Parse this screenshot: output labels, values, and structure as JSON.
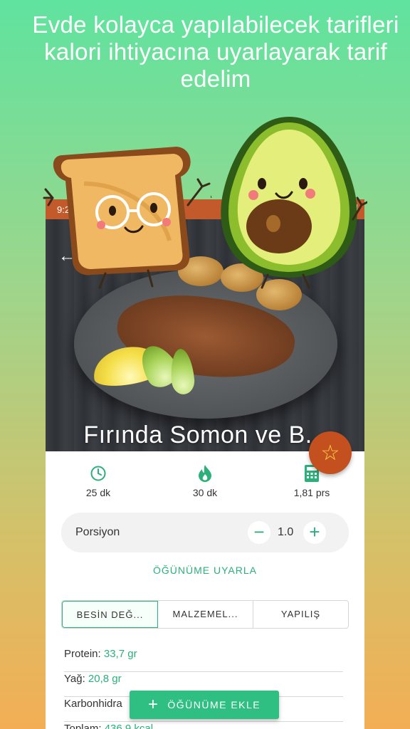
{
  "headline": "Evde kolayca yapılabilecek tarifleri kalori ihtiyacına uyarlayarak tarif edelim",
  "status_bar": {
    "time": "9:2"
  },
  "recipe": {
    "title": "Fırında Somon ve B..."
  },
  "stats": [
    {
      "icon": "clock-icon",
      "value": "25 dk"
    },
    {
      "icon": "flame-icon",
      "value": "30 dk"
    },
    {
      "icon": "calculator-icon",
      "value": "1,81 prs"
    }
  ],
  "portion": {
    "label": "Porsiyon",
    "value": "1.0",
    "minus": "−",
    "plus": "+"
  },
  "adapt_link": "ÖĞÜNÜME UYARLA",
  "tabs": [
    "BESİN DEĞ...",
    "MALZEMEL...",
    "YAPILIŞ"
  ],
  "nutrition": [
    {
      "key": "Protein: ",
      "value": "33,7 gr"
    },
    {
      "key": "Yağ: ",
      "value": "20,8 gr"
    },
    {
      "key": "Karbonhidra",
      "value": ""
    },
    {
      "key": "Toplam: ",
      "value": "436,9 kcal"
    }
  ],
  "add_button": {
    "icon": "plus-icon",
    "label": "ÖĞÜNÜME EKLE"
  },
  "colors": {
    "accent": "#2bb07a",
    "status_bar": "#c35a2c",
    "fav": "#c3501e"
  }
}
